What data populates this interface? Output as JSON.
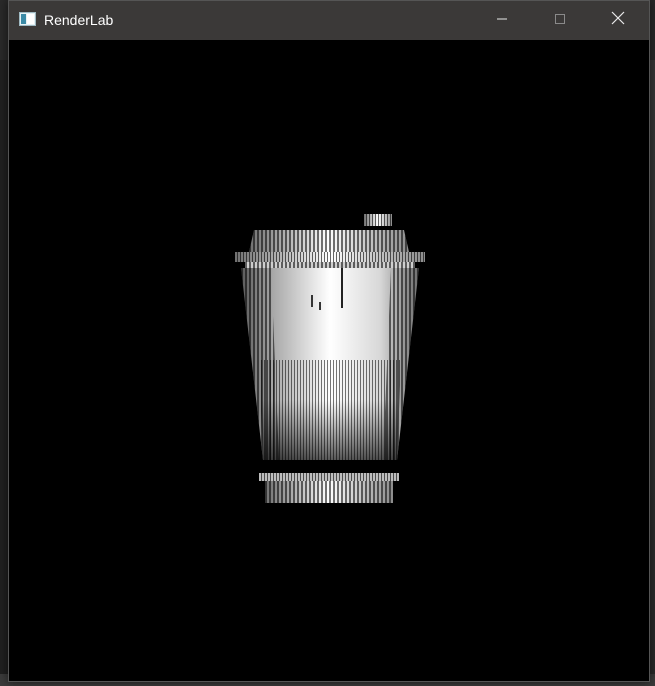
{
  "window": {
    "title": "RenderLab",
    "icon": "app-window-icon",
    "controls": {
      "minimize_icon": "minimize-icon",
      "maximize_icon": "maximize-icon",
      "close_icon": "close-icon"
    }
  },
  "viewport": {
    "content": "rendered-cup-model",
    "background": "#000000"
  },
  "colors": {
    "titlebar": "#3b3938",
    "title_text": "#ffffff",
    "viewport_bg": "#000000"
  }
}
